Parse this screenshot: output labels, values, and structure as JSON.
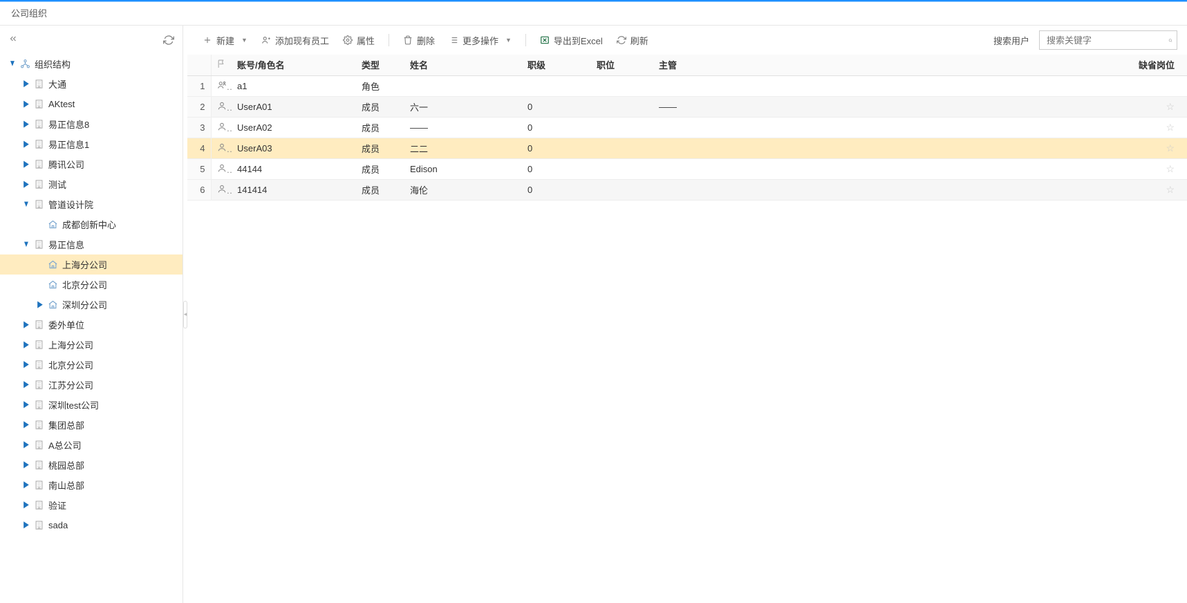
{
  "breadcrumb": "公司组织",
  "toolbar": {
    "new": "新建",
    "addExisting": "添加现有员工",
    "properties": "属性",
    "delete": "删除",
    "more": "更多操作",
    "export": "导出到Excel",
    "refresh": "刷新",
    "searchLabel": "搜索用户",
    "searchPlaceholder": "搜索关键字"
  },
  "tree": [
    {
      "level": 0,
      "caret": "down",
      "icon": "org",
      "label": "组织结构"
    },
    {
      "level": 1,
      "caret": "right",
      "icon": "building",
      "label": "大通"
    },
    {
      "level": 1,
      "caret": "right",
      "icon": "building",
      "label": "AKtest"
    },
    {
      "level": 1,
      "caret": "right",
      "icon": "building",
      "label": "易正信息8"
    },
    {
      "level": 1,
      "caret": "right",
      "icon": "building",
      "label": "易正信息1"
    },
    {
      "level": 1,
      "caret": "right",
      "icon": "building",
      "label": "腾讯公司"
    },
    {
      "level": 1,
      "caret": "right",
      "icon": "building",
      "label": "测试"
    },
    {
      "level": 1,
      "caret": "down",
      "icon": "building",
      "label": "管道设计院"
    },
    {
      "level": 2,
      "caret": "none",
      "icon": "house",
      "label": "成都创新中心"
    },
    {
      "level": 1,
      "caret": "down",
      "icon": "building",
      "label": "易正信息"
    },
    {
      "level": 2,
      "caret": "none",
      "icon": "house",
      "label": "上海分公司",
      "selected": true
    },
    {
      "level": 2,
      "caret": "none",
      "icon": "house",
      "label": "北京分公司"
    },
    {
      "level": 2,
      "caret": "right",
      "icon": "house",
      "label": "深圳分公司"
    },
    {
      "level": 1,
      "caret": "right",
      "icon": "building",
      "label": "委外单位"
    },
    {
      "level": 1,
      "caret": "right",
      "icon": "building",
      "label": "上海分公司"
    },
    {
      "level": 1,
      "caret": "right",
      "icon": "building",
      "label": "北京分公司"
    },
    {
      "level": 1,
      "caret": "right",
      "icon": "building",
      "label": "江苏分公司"
    },
    {
      "level": 1,
      "caret": "right",
      "icon": "building",
      "label": "深圳test公司"
    },
    {
      "level": 1,
      "caret": "right",
      "icon": "building",
      "label": "集团总部"
    },
    {
      "level": 1,
      "caret": "right",
      "icon": "building",
      "label": "A总公司"
    },
    {
      "level": 1,
      "caret": "right",
      "icon": "building",
      "label": "桃园总部"
    },
    {
      "level": 1,
      "caret": "right",
      "icon": "building",
      "label": "南山总部"
    },
    {
      "level": 1,
      "caret": "right",
      "icon": "building",
      "label": "验证"
    },
    {
      "level": 1,
      "caret": "right",
      "icon": "building",
      "label": "sada"
    }
  ],
  "columns": {
    "flag": "",
    "account": "账号/角色名",
    "type": "类型",
    "name": "姓名",
    "rank": "职级",
    "position": "职位",
    "manager": "主管",
    "default": "缺省岗位"
  },
  "rows": [
    {
      "idx": "1",
      "icon": "role",
      "account": "a1",
      "type": "角色",
      "name": "",
      "rank": "",
      "position": "",
      "manager": "",
      "star": false
    },
    {
      "idx": "2",
      "icon": "user",
      "account": "UserA01",
      "type": "成员",
      "name": "六一",
      "rank": "0",
      "position": "",
      "manager": "——",
      "star": true
    },
    {
      "idx": "3",
      "icon": "user",
      "account": "UserA02",
      "type": "成员",
      "name": "——",
      "rank": "0",
      "position": "",
      "manager": "",
      "star": true
    },
    {
      "idx": "4",
      "icon": "user",
      "account": "UserA03",
      "type": "成员",
      "name": "二二",
      "rank": "0",
      "position": "",
      "manager": "",
      "star": true,
      "selected": true
    },
    {
      "idx": "5",
      "icon": "user",
      "account": "44144",
      "type": "成员",
      "name": "Edison",
      "rank": "0",
      "position": "",
      "manager": "",
      "star": true
    },
    {
      "idx": "6",
      "icon": "user",
      "account": "141414",
      "type": "成员",
      "name": "海伦",
      "rank": "0",
      "position": "",
      "manager": "",
      "star": true
    }
  ]
}
